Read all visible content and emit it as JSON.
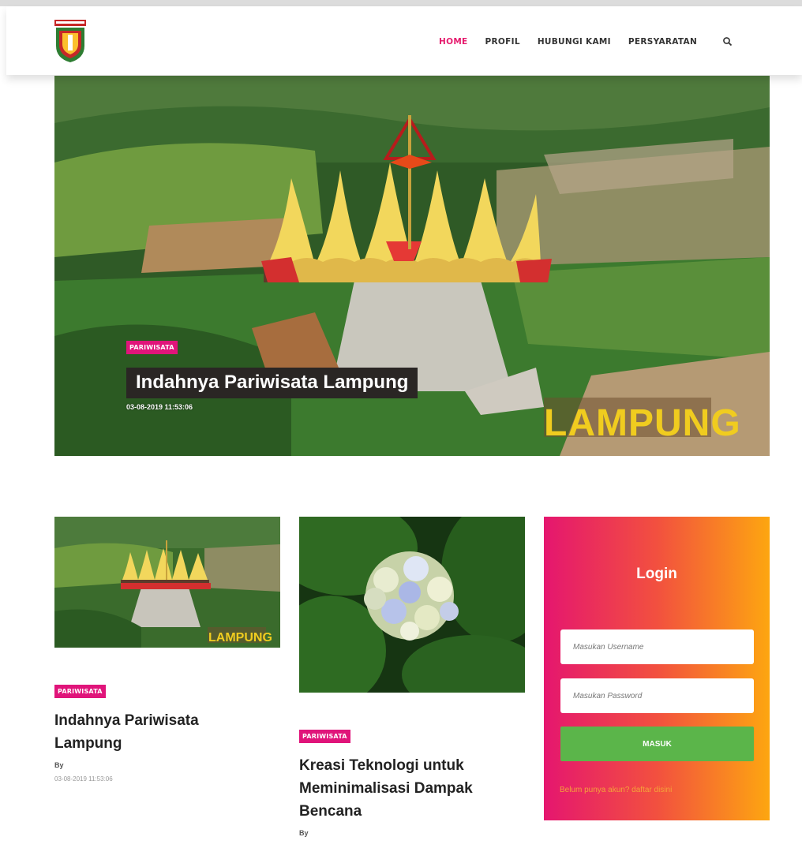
{
  "nav": {
    "items": [
      {
        "label": "HOME",
        "active": true
      },
      {
        "label": "PROFIL",
        "active": false
      },
      {
        "label": "HUBUNGI KAMI",
        "active": false
      },
      {
        "label": "PERSYARATAN",
        "active": false
      }
    ],
    "search_icon": "search-icon",
    "active_color": "#e51c6e"
  },
  "logo": {
    "icon": "provincial-crest-logo"
  },
  "hero": {
    "category": "PARIWISATA",
    "title": "Indahnya Pariwisata Lampung",
    "date": "03-08-2019 11:53:06",
    "sign_text": "LAMPUNG"
  },
  "articles": [
    {
      "category": "PARIWISATA",
      "title": "Indahnya Pariwisata Lampung",
      "by": "By",
      "date": "03-08-2019 11:53:06",
      "thumb_sign": "LAMPUNG"
    },
    {
      "category": "PARIWISATA",
      "title": "Kreasi Teknologi untuk Meminimalisasi Dampak Bencana",
      "by": "By"
    }
  ],
  "login": {
    "title": "Login",
    "username_placeholder": "Masukan Username",
    "password_placeholder": "Masukan Password",
    "submit_label": "MASUK",
    "register_text": "Belum punya akun? daftar disini",
    "colors": {
      "gradient_start": "#e5166f",
      "gradient_end": "#fda610",
      "button": "#5bb54a"
    }
  },
  "colors": {
    "accent": "#e0147a"
  }
}
